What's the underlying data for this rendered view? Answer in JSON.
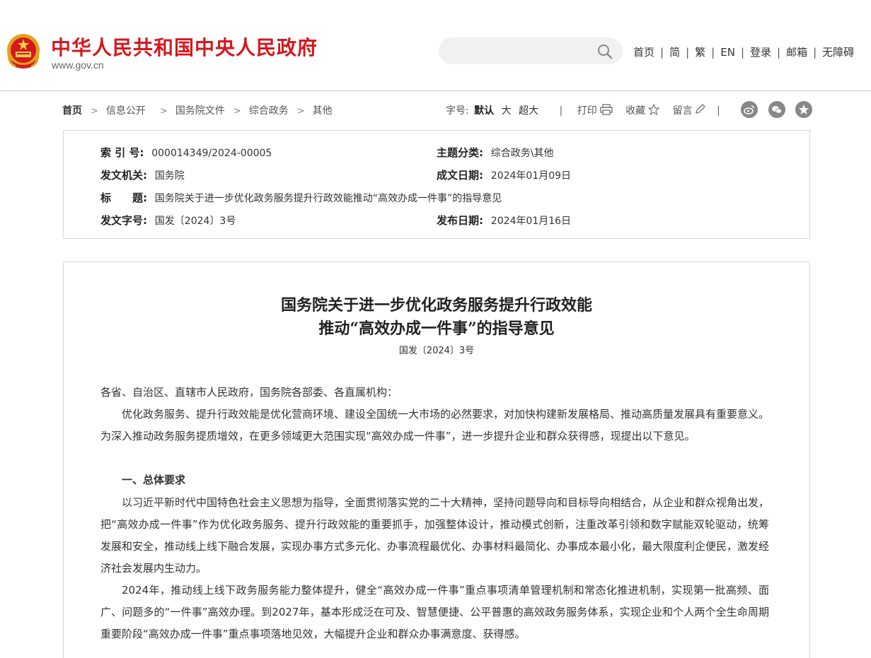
{
  "site": {
    "title": "中华人民共和国中央人民政府",
    "url": "www.gov.cn"
  },
  "search": {
    "placeholder": ""
  },
  "top_nav": {
    "home": "首页",
    "simplified": "简",
    "traditional": "繁",
    "english": "EN",
    "login": "登录",
    "mail": "邮箱",
    "accessibility": "无障碍",
    "separator": "|"
  },
  "breadcrumb": [
    "首页",
    "信息公开",
    "国务院文件",
    "综合政务",
    "其他"
  ],
  "tools": {
    "font_size_label": "字号:",
    "size_default": "默认",
    "size_large": "大",
    "size_xlarge": "超大",
    "print": "打印",
    "favorite": "收藏",
    "comment": "留言",
    "separator": "|"
  },
  "meta": {
    "index_label": "索 引 号:",
    "index_value": "000014349/2024-00005",
    "category_label": "主题分类:",
    "category_value": "综合政务\\其他",
    "issuer_label": "发文机关:",
    "issuer_value": "国务院",
    "written_label": "成文日期:",
    "written_value": "2024年01月09日",
    "title_label": "标　　题:",
    "title_value": "国务院关于进一步优化政务服务提升行政效能推动“高效办成一件事”的指导意见",
    "docno_label": "发文字号:",
    "docno_value": "国发〔2024〕3号",
    "published_label": "发布日期:",
    "published_value": "2024年01月16日"
  },
  "article": {
    "title_line1": "国务院关于进一步优化政务服务提升行政效能",
    "title_line2": "推动“高效办成一件事”的指导意见",
    "doc_number": "国发〔2024〕3号",
    "salutation": "各省、自治区、直辖市人民政府，国务院各部委、各直属机构：",
    "p1": "优化政务服务、提升行政效能是优化营商环境、建设全国统一大市场的必然要求，对加快构建新发展格局、推动高质量发展具有重要意义。为深入推动政务服务提质增效，在更多领域更大范围实现“高效办成一件事”，进一步提升企业和群众获得感，现提出以下意见。",
    "section1": "一、总体要求",
    "p2": "以习近平新时代中国特色社会主义思想为指导，全面贯彻落实党的二十大精神，坚持问题导向和目标导向相结合，从企业和群众视角出发，把“高效办成一件事”作为优化政务服务、提升行政效能的重要抓手，加强整体设计，推动模式创新，注重改革引领和数字赋能双轮驱动，统筹发展和安全，推动线上线下融合发展，实现办事方式多元化、办事流程最优化、办事材料最简化、办事成本最小化，最大限度利企便民，激发经济社会发展内生动力。",
    "p3": "2024年，推动线上线下政务服务能力整体提升，健全“高效办成一件事”重点事项清单管理机制和常态化推进机制，实现第一批高频、面广、问题多的“一件事”高效办理。到2027年，基本形成泛在可及、智慧便捷、公平普惠的高效政务服务体系，实现企业和个人两个全生命周期重要阶段“高效办成一件事”重点事项落地见效，大幅提升企业和群众办事满意度、获得感。"
  },
  "colors": {
    "brand_red": "#d5181d",
    "border": "#d9d9d9",
    "icon_gray": "#888888"
  }
}
